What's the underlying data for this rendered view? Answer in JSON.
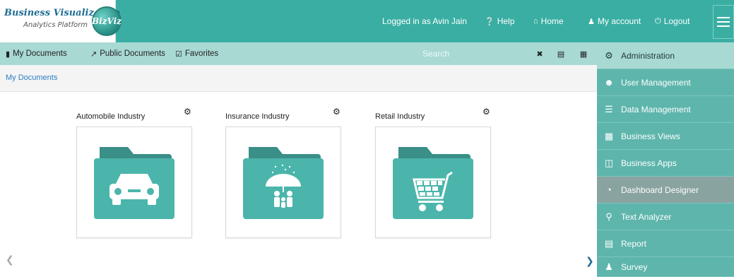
{
  "header": {
    "logo_title": "Business Visualization",
    "logo_subtitle": "Analytics Platform",
    "logo_badge": "BizViz",
    "logged_in": "Logged in as Avin Jain",
    "help": "Help",
    "home": "Home",
    "my_account": "My account",
    "logout": "Logout"
  },
  "toolbar": {
    "my_documents": "My Documents",
    "public_documents": "Public Documents",
    "favorites": "Favorites",
    "search_placeholder": "Search"
  },
  "breadcrumb": {
    "current": "My Documents"
  },
  "cards": [
    {
      "title": "Automobile Industry",
      "icon": "car-icon"
    },
    {
      "title": "Insurance Industry",
      "icon": "umbrella-family-icon"
    },
    {
      "title": "Retail Industry",
      "icon": "shopping-cart-icon"
    }
  ],
  "menu": {
    "items": [
      {
        "label": "Administration",
        "icon": "admin-icon"
      },
      {
        "label": "User Management",
        "icon": "users-icon"
      },
      {
        "label": "Data Management",
        "icon": "database-icon"
      },
      {
        "label": "Business Views",
        "icon": "business-views-icon"
      },
      {
        "label": "Business Apps",
        "icon": "business-apps-icon"
      },
      {
        "label": "Dashboard Designer",
        "icon": "dashboard-designer-icon"
      },
      {
        "label": "Text Analyzer",
        "icon": "text-analyzer-icon"
      },
      {
        "label": "Report",
        "icon": "report-icon"
      },
      {
        "label": "Survey",
        "icon": "survey-icon"
      }
    ]
  },
  "colors": {
    "header": "#3aaea3",
    "toolbar": "#a9d9d3",
    "menu": "#5eb5ac",
    "menu_active": "#89a3a0",
    "folder": "#4bb5ab",
    "folder_tab": "#3a8f88"
  }
}
